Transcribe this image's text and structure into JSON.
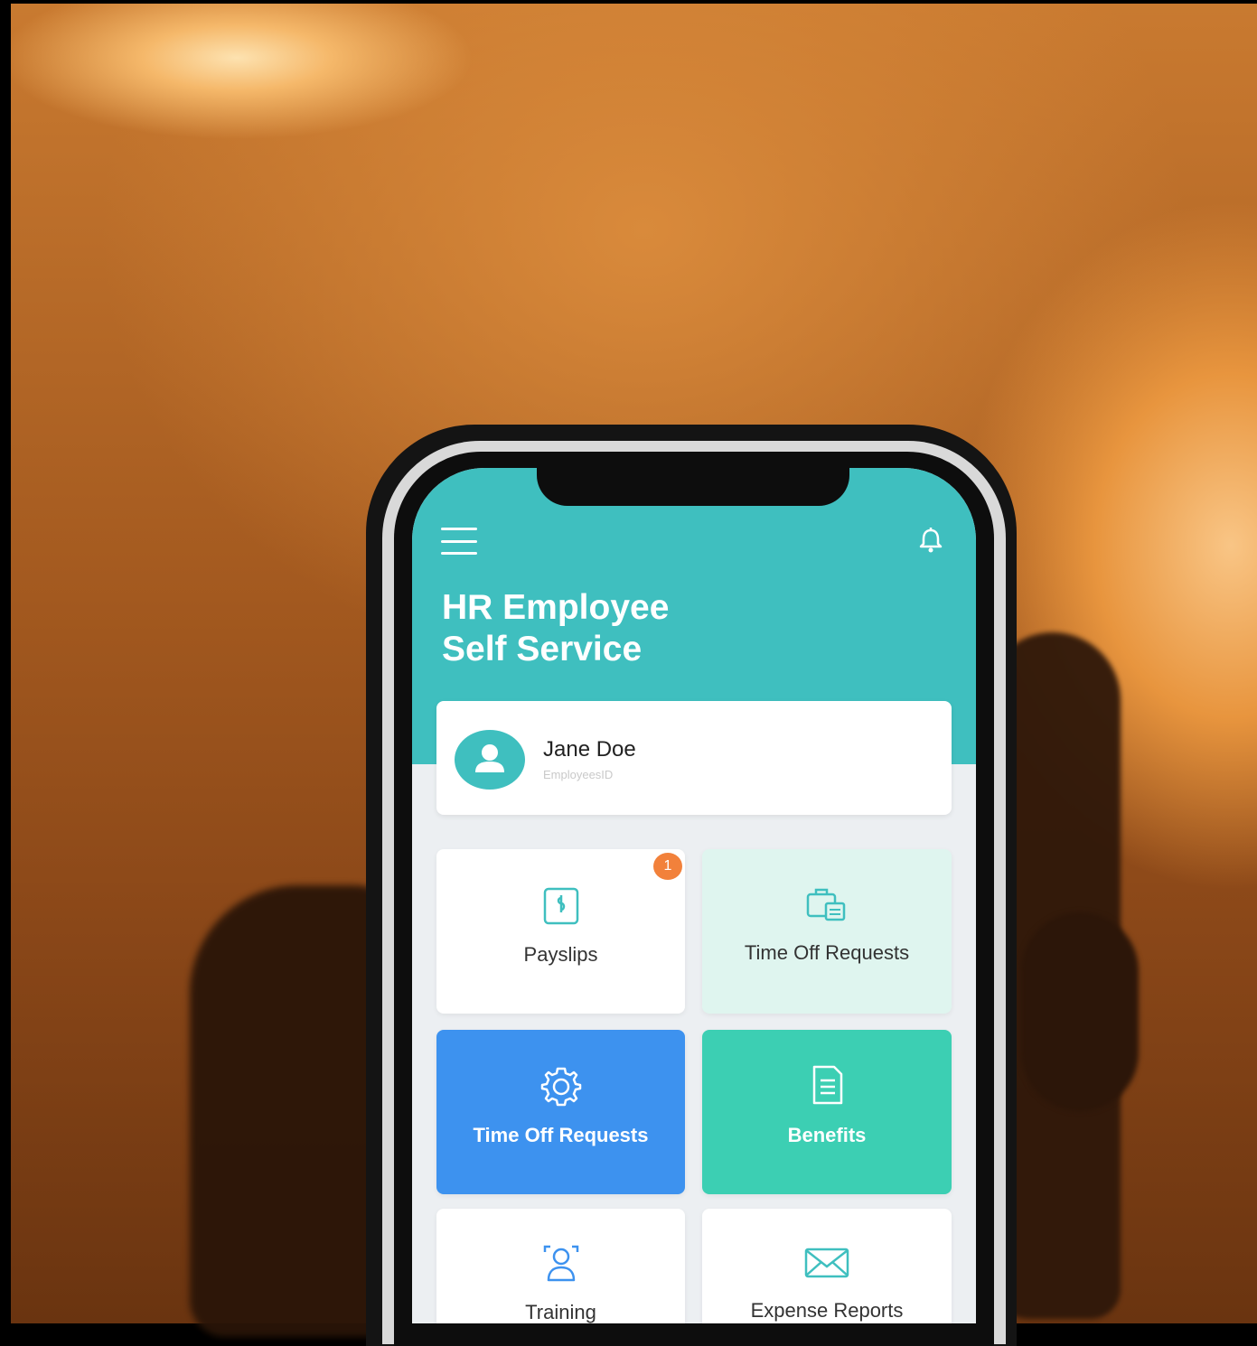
{
  "app": {
    "title_line1": "HR Employee",
    "title_line2": "Self Service"
  },
  "profile": {
    "name": "Jane Doe",
    "employee_id_label": "EmployeesID"
  },
  "tiles": [
    {
      "label": "Payslips",
      "icon": "payslip-icon",
      "badge": "1"
    },
    {
      "label": "Time Off Requests",
      "icon": "briefcase-calendar-icon"
    },
    {
      "label": "Time Off Requests",
      "icon": "gear-icon"
    },
    {
      "label": "Benefits",
      "icon": "document-icon"
    },
    {
      "label": "Training",
      "icon": "user-focus-icon"
    },
    {
      "label": "Expense Reports",
      "icon": "envelope-icon"
    }
  ],
  "colors": {
    "header": "#3fbfbf",
    "accent": "#3fbfbf",
    "badge": "#f2813b",
    "tile_blue": "#3d92ef",
    "tile_green": "#3ccfb3",
    "tile_mint": "#dff5ef"
  }
}
